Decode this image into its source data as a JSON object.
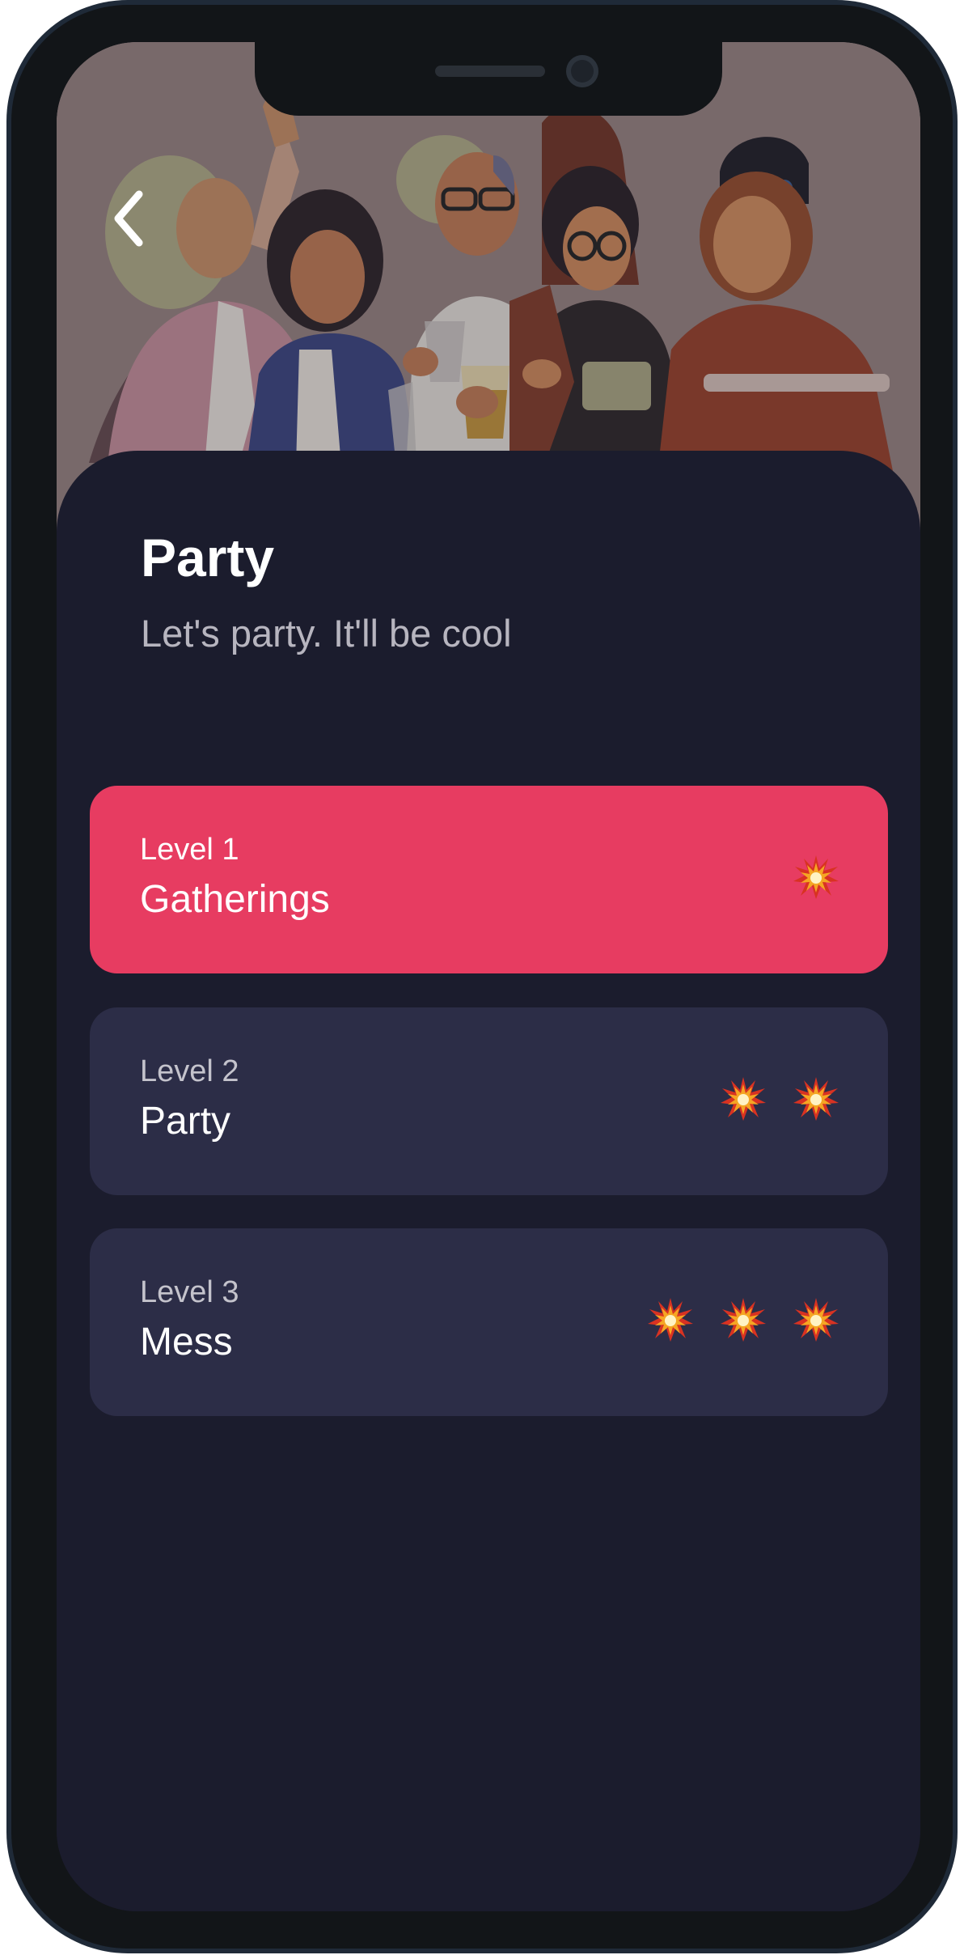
{
  "page": {
    "title": "Party",
    "subtitle": "Let's party. It'll be cool"
  },
  "hero": {
    "illustration": "group-of-friends-toasting-illustration"
  },
  "navigation": {
    "back_icon": "chevron-left-icon"
  },
  "levels": [
    {
      "label": "Level 1",
      "name": "Gatherings",
      "intensity": 1,
      "selected": true
    },
    {
      "label": "Level 2",
      "name": "Party",
      "intensity": 2,
      "selected": false
    },
    {
      "label": "Level 3",
      "name": "Mess",
      "intensity": 3,
      "selected": false
    }
  ],
  "colors": {
    "background": "#1b1c2d",
    "card": "#2c2d47",
    "accent": "#e73c61",
    "hero_tint": "#8d7a78"
  },
  "icons": {
    "intensity": "collision-icon"
  }
}
